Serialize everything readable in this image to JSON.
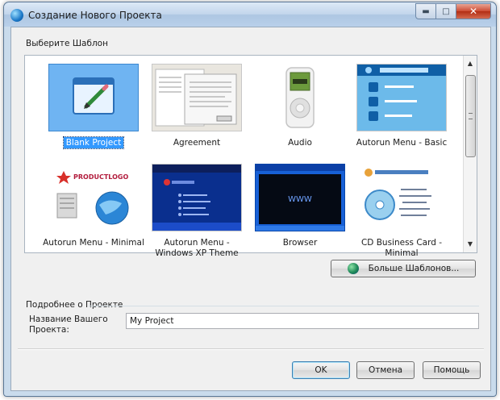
{
  "window": {
    "title": "Создание Нового Проекта"
  },
  "templates": {
    "label": "Выберите Шаблон",
    "items": [
      {
        "label": "Blank Project",
        "selected": true,
        "icon": "blank-project-thumbnail"
      },
      {
        "label": "Agreement",
        "selected": false,
        "icon": "agreement-thumbnail"
      },
      {
        "label": "Audio",
        "selected": false,
        "icon": "audio-player-thumbnail"
      },
      {
        "label": "Autorun Menu - Basic",
        "selected": false,
        "icon": "autorun-basic-thumbnail"
      },
      {
        "label": "Autorun Menu - Minimal",
        "selected": false,
        "icon": "autorun-minimal-thumbnail"
      },
      {
        "label": "Autorun Menu - Windows XP Theme",
        "selected": false,
        "icon": "autorun-xp-thumbnail"
      },
      {
        "label": "Browser",
        "selected": false,
        "icon": "browser-thumbnail"
      },
      {
        "label": "CD Business Card - Minimal",
        "selected": false,
        "icon": "cd-business-card-thumbnail"
      }
    ],
    "thumb_texts": {
      "productlogo": "PRODUCTLOGO",
      "www": "WWW"
    },
    "more_button": "Больше Шаблонов..."
  },
  "details": {
    "label": "Подробнее о Проекте",
    "name_label_line1": "Название Вашего",
    "name_label_line2": "Проекта:",
    "name_value": "My Project"
  },
  "buttons": {
    "ok": "OK",
    "cancel": "Отмена",
    "help": "Помощь"
  },
  "colors": {
    "selection": "#3399ff",
    "title_gradient": "#b9d0ea",
    "client_bg": "#f0f0f0"
  }
}
